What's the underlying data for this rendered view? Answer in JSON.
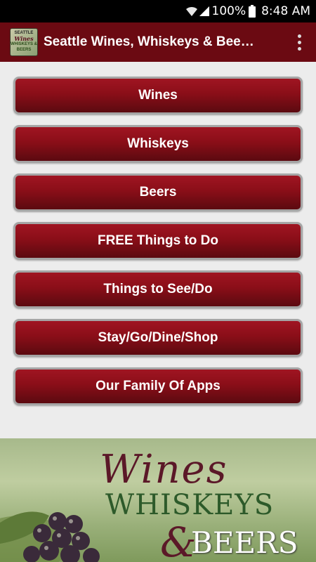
{
  "status_bar": {
    "battery_percent": "100%",
    "time": "8:48 AM"
  },
  "app_bar": {
    "title": "Seattle Wines, Whiskeys & Bee…",
    "icon_text": [
      "SEATTLE",
      "Wines",
      "WHISKEYS & BEERS"
    ]
  },
  "menu": {
    "items": [
      {
        "label": "Wines"
      },
      {
        "label": "Whiskeys"
      },
      {
        "label": "Beers"
      },
      {
        "label": "FREE Things to Do"
      },
      {
        "label": "Things to See/Do"
      },
      {
        "label": "Stay/Go/Dine/Shop"
      },
      {
        "label": "Our Family Of Apps"
      }
    ]
  },
  "banner": {
    "line1": "Wines",
    "line2": "WHISKEYS",
    "line3_amp": "&",
    "line3": "BEERS"
  },
  "colors": {
    "app_bar": "#6b0a12",
    "button_top": "#a01522",
    "button_bottom": "#5b0a10",
    "background": "#ececec"
  }
}
